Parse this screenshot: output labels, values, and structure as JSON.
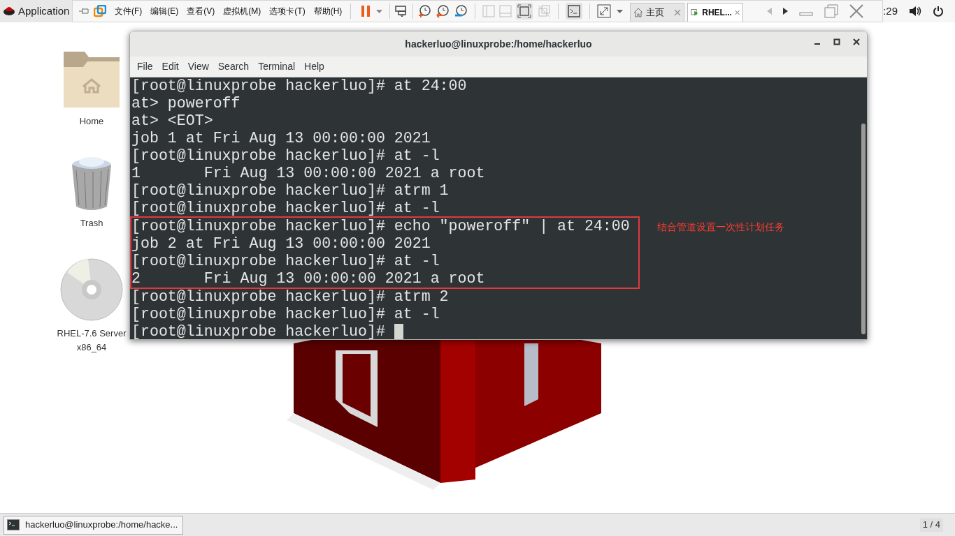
{
  "top_bar": {
    "app_menu": "Application",
    "clock": ":29"
  },
  "vm_toolbar": {
    "menus": [
      "文件(F)",
      "编辑(E)",
      "查看(V)",
      "虚拟机(M)",
      "选项卡(T)",
      "帮助(H)"
    ],
    "tabs": [
      {
        "label": "主页",
        "selected": false
      },
      {
        "label": "RHEL...",
        "selected": true
      }
    ]
  },
  "desktop_icons": [
    {
      "kind": "folder",
      "label": "Home"
    },
    {
      "kind": "trash",
      "label": "Trash"
    },
    {
      "kind": "disc",
      "label": "RHEL-7.6 Server x86_64"
    }
  ],
  "terminal": {
    "title": "hackerluo@linuxprobe:/home/hackerluo",
    "menu": [
      "File",
      "Edit",
      "View",
      "Search",
      "Terminal",
      "Help"
    ],
    "lines": [
      {
        "text": "[root@linuxprobe hackerluo]# at 24:00",
        "highlighted": false
      },
      {
        "text": "at> poweroff",
        "highlighted": false
      },
      {
        "text": "at> <EOT>",
        "highlighted": false
      },
      {
        "text": "job 1 at Fri Aug 13 00:00:00 2021",
        "highlighted": false
      },
      {
        "text": "[root@linuxprobe hackerluo]# at -l",
        "highlighted": false
      },
      {
        "text": "1       Fri Aug 13 00:00:00 2021 a root",
        "highlighted": false
      },
      {
        "text": "[root@linuxprobe hackerluo]# atrm 1",
        "highlighted": false
      },
      {
        "text": "[root@linuxprobe hackerluo]# at -l",
        "highlighted": false
      },
      {
        "text": "[root@linuxprobe hackerluo]# echo \"poweroff\" | at 24:00",
        "highlighted": true
      },
      {
        "text": "job 2 at Fri Aug 13 00:00:00 2021",
        "highlighted": true
      },
      {
        "text": "[root@linuxprobe hackerluo]# at -l",
        "highlighted": true
      },
      {
        "text": "2       Fri Aug 13 00:00:00 2021 a root",
        "highlighted": true
      },
      {
        "text": "[root@linuxprobe hackerluo]# atrm 2",
        "highlighted": false
      },
      {
        "text": "[root@linuxprobe hackerluo]# at -l",
        "highlighted": false
      },
      {
        "text": "[root@linuxprobe hackerluo]# ",
        "highlighted": false
      }
    ],
    "cursor": true,
    "annotation": "结合管道设置一次性计划任务"
  },
  "taskbar": {
    "items": [
      {
        "label": "hackerluo@linuxprobe:/home/hacke...",
        "selected": true
      }
    ],
    "workspace": "1 / 4"
  }
}
